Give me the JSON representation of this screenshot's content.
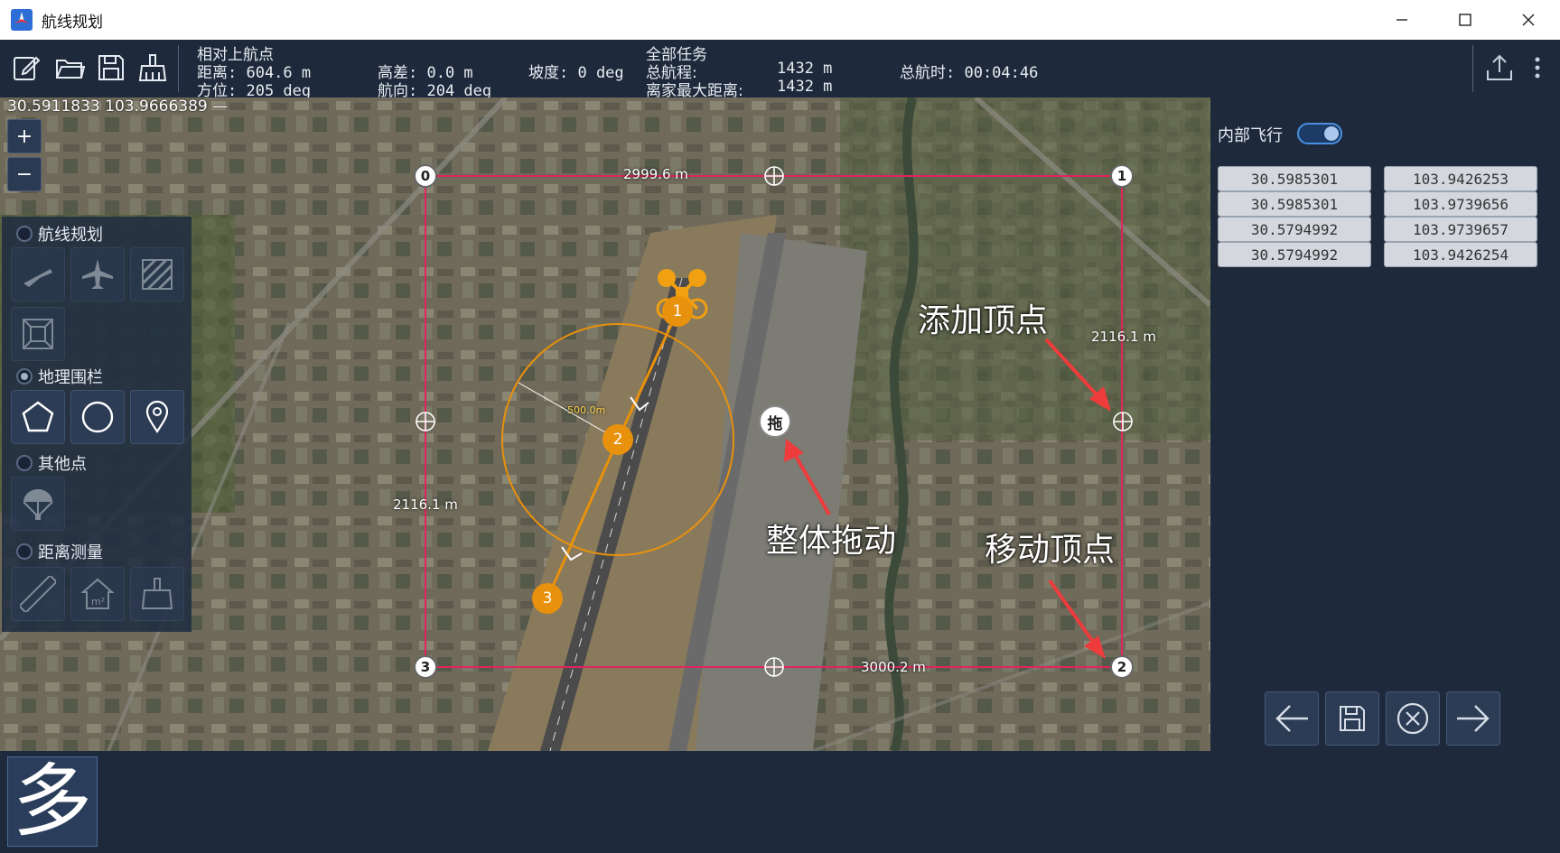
{
  "window": {
    "title": "航线规划",
    "minimize_glyph": "—",
    "maximize_glyph": "☐",
    "close_glyph": "✕"
  },
  "toolbar": {
    "icons": [
      "edit-icon",
      "folder-open-icon",
      "save-icon",
      "broom-clear-icon",
      "upload-icon",
      "more-icon"
    ],
    "relative_header": "相对上航点",
    "distance": "距离: 604.6 m",
    "bearing": "方位: 205 deg",
    "height_diff": "高差: 0.0 m",
    "heading": "航向: 204 deg",
    "slope": "坡度: 0 deg",
    "all_tasks_header": "全部任务",
    "total_range_label": "总航程:",
    "total_range_value": "1432 m",
    "max_home_label": "离家最大距离:",
    "max_home_value": "1432 m",
    "total_time": "总航时: 00:04:46"
  },
  "map": {
    "coord_readout": "30.5911833 103.9666389 —",
    "zoom_in": "+",
    "zoom_out": "−",
    "edge_top": "2999.6 m",
    "edge_right": "2116.1 m",
    "edge_left": "2116.1 m",
    "edge_bottom": "3000.2 m",
    "radius_label": "500.0m",
    "vertices": [
      "0",
      "1",
      "2",
      "3"
    ],
    "waypoints": [
      "1",
      "2",
      "3"
    ],
    "drag_handle": "拖",
    "annotations": {
      "add_vertex": "添加顶点",
      "drag_whole": "整体拖动",
      "move_vertex": "移动顶点"
    },
    "colors": {
      "fence": "#e0245e",
      "route": "#e8910c",
      "arrow": "#ee3b3b"
    }
  },
  "tool_panel": {
    "route_planning": "航线规划",
    "geofence": "地理围栏",
    "other_points": "其他点",
    "distance_measure": "距离测量",
    "route_icons": [
      "takeoff-icon",
      "airplane-icon",
      "hatch-area-icon",
      "frame-area-icon"
    ],
    "fence_icons": [
      "polygon-icon",
      "circle-icon",
      "location-pin-icon"
    ],
    "other_icons": [
      "parachute-icon"
    ],
    "measure_icons": [
      "ruler-icon",
      "area-house-icon",
      "broom-icon"
    ]
  },
  "side_panel": {
    "inner_flight": "内部飞行",
    "coords": [
      {
        "lat": "30.5985301",
        "lon": "103.9426253"
      },
      {
        "lat": "30.5985301",
        "lon": "103.9739656"
      },
      {
        "lat": "30.5794992",
        "lon": "103.9739657"
      },
      {
        "lat": "30.5794992",
        "lon": "103.9426254"
      }
    ],
    "nav_icons": [
      "arrow-left-icon",
      "save-icon",
      "cancel-circle-icon",
      "arrow-right-icon"
    ]
  },
  "bottom": {
    "big_char": "多"
  }
}
